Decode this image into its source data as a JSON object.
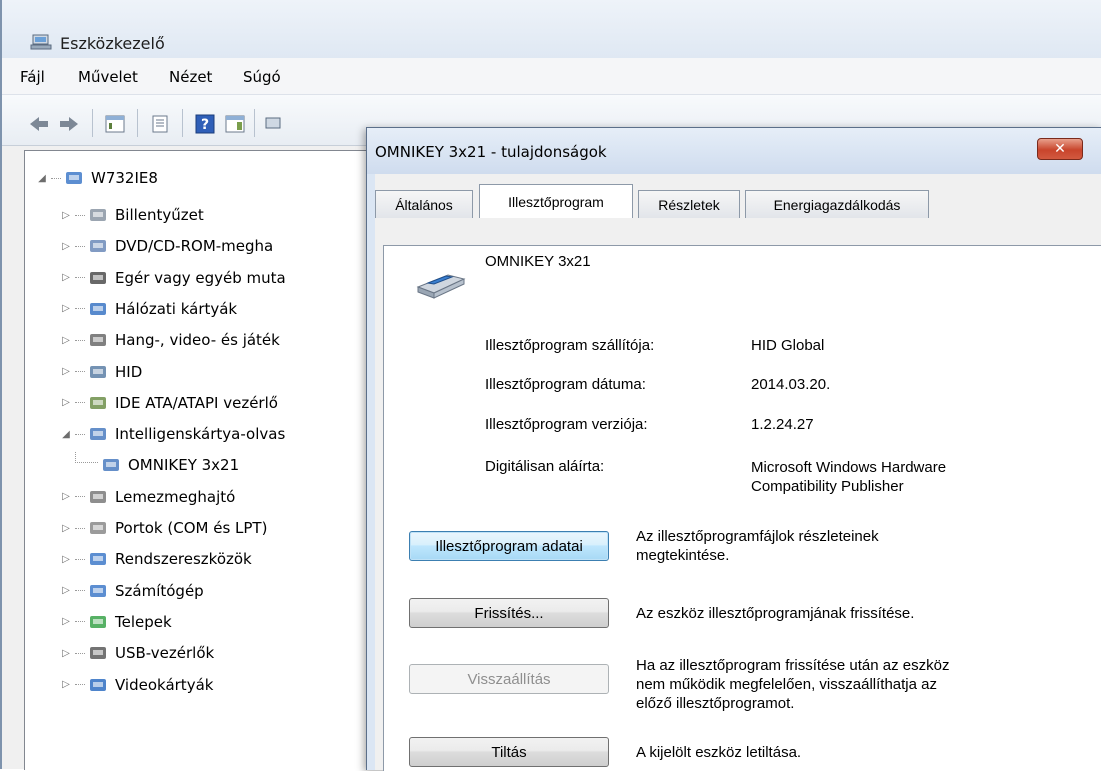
{
  "main_window": {
    "title": "Eszközkezelő",
    "menu": [
      "Fájl",
      "Művelet",
      "Nézet",
      "Súgó"
    ],
    "tree": {
      "root": "W732IE8",
      "items": [
        {
          "label": "Billentyűzet",
          "expanded": false,
          "icon": "keyboard-icon"
        },
        {
          "label": "DVD/CD-ROM-megha",
          "expanded": false,
          "icon": "dvd-drive-icon"
        },
        {
          "label": "Egér vagy egyéb muta",
          "expanded": false,
          "icon": "mouse-icon"
        },
        {
          "label": "Hálózati kártyák",
          "expanded": false,
          "icon": "network-adapter-icon"
        },
        {
          "label": "Hang-, video- és játék",
          "expanded": false,
          "icon": "sound-icon"
        },
        {
          "label": "HID",
          "expanded": false,
          "icon": "hid-icon"
        },
        {
          "label": "IDE ATA/ATAPI vezérlő",
          "expanded": false,
          "icon": "ide-controller-icon"
        },
        {
          "label": "Intelligenskártya-olvas",
          "expanded": true,
          "icon": "smartcard-reader-icon"
        },
        {
          "label": "OMNIKEY 3x21",
          "child": true,
          "icon": "smartcard-device-icon"
        },
        {
          "label": "Lemezmeghajtó",
          "expanded": false,
          "icon": "disk-drive-icon"
        },
        {
          "label": "Portok (COM és LPT)",
          "expanded": false,
          "icon": "port-icon"
        },
        {
          "label": "Rendszereszközök",
          "expanded": false,
          "icon": "system-devices-icon"
        },
        {
          "label": "Számítógép",
          "expanded": false,
          "icon": "computer-icon"
        },
        {
          "label": "Telepek",
          "expanded": false,
          "icon": "battery-icon"
        },
        {
          "label": "USB-vezérlők",
          "expanded": false,
          "icon": "usb-icon"
        },
        {
          "label": "Videokártyák",
          "expanded": false,
          "icon": "display-adapter-icon"
        }
      ]
    }
  },
  "dialog": {
    "title": "OMNIKEY 3x21 - tulajdonságok",
    "close_glyph": "✕",
    "tabs": [
      {
        "label": "Általános",
        "active": false
      },
      {
        "label": "Illesztőprogram",
        "active": true
      },
      {
        "label": "Részletek",
        "active": false
      },
      {
        "label": "Energiagazdálkodás",
        "active": false
      }
    ],
    "device_name": "OMNIKEY 3x21",
    "properties": [
      {
        "label": "Illesztőprogram szállítója:",
        "value": "HID Global"
      },
      {
        "label": "Illesztőprogram dátuma:",
        "value": "2014.03.20."
      },
      {
        "label": "Illesztőprogram verziója:",
        "value": "1.2.24.27"
      },
      {
        "label": "Digitálisan aláírta:",
        "value": "Microsoft Windows Hardware\nCompatibility Publisher"
      }
    ],
    "actions": [
      {
        "label": "Illesztőprogram adatai",
        "description": "Az illesztőprogramfájlok részleteinek\nmegtekintése.",
        "state": "focused"
      },
      {
        "label": "Frissítés...",
        "description": "Az eszköz illesztőprogramjának frissítése.",
        "state": "normal"
      },
      {
        "label": "Visszaállítás",
        "description": "Ha az illesztőprogram frissítése után az eszköz\nnem működik megfelelően, visszaállíthatja az\nelőző illesztőprogramot.",
        "state": "disabled"
      },
      {
        "label": "Tiltás",
        "description": "A kijelölt eszköz letiltása.",
        "state": "normal"
      }
    ]
  }
}
